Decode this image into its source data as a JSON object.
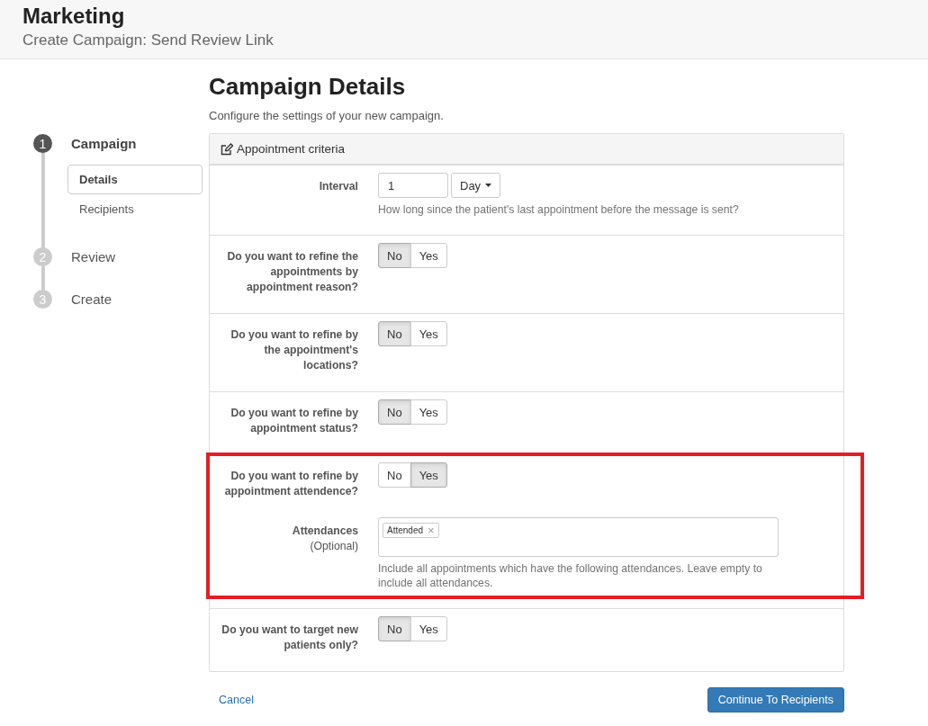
{
  "header": {
    "title": "Marketing",
    "subtitle": "Create Campaign: Send Review Link"
  },
  "steps": [
    {
      "number": "1",
      "label": "Campaign",
      "selected": true,
      "children": [
        {
          "label": "Details",
          "selected": true
        },
        {
          "label": "Recipients",
          "selected": false
        }
      ]
    },
    {
      "number": "2",
      "label": "Review",
      "selected": false
    },
    {
      "number": "3",
      "label": "Create",
      "selected": false
    }
  ],
  "page": {
    "title": "Campaign Details",
    "description": "Configure the settings of your new campaign."
  },
  "panel": {
    "title": "Appointment criteria",
    "fields": [
      {
        "kind": "interval",
        "label": "Interval",
        "value": "1",
        "unit": "Day",
        "help": "How long since the patient's last appointment before the message is sent?"
      },
      {
        "kind": "toggle",
        "label": "Do you want to refine the appointments by appointment reason?",
        "highlighted": false,
        "options": [
          {
            "label": "No",
            "selected": true
          },
          {
            "label": "Yes",
            "selected": false
          }
        ]
      },
      {
        "kind": "toggle",
        "label": "Do you want to refine by the appointment's locations?",
        "highlighted": false,
        "options": [
          {
            "label": "No",
            "selected": true
          },
          {
            "label": "Yes",
            "selected": false
          }
        ]
      },
      {
        "kind": "toggle",
        "label": "Do you want to refine by appointment status?",
        "highlighted": false,
        "options": [
          {
            "label": "No",
            "selected": true
          },
          {
            "label": "Yes",
            "selected": false
          }
        ]
      },
      {
        "kind": "toggle",
        "label": "Do you want to refine by appointment attendence?",
        "highlighted": true,
        "options": [
          {
            "label": "No",
            "selected": false
          },
          {
            "label": "Yes",
            "selected": true
          }
        ],
        "sub": {
          "label": "Attendances",
          "note": "(Optional)",
          "tags": [
            "Attended"
          ],
          "tag_remove": "×",
          "help": "Include all appointments which have the following attendances. Leave empty to include all attendances."
        }
      },
      {
        "kind": "toggle",
        "label": "Do you want to target new patients only?",
        "highlighted": false,
        "options": [
          {
            "label": "No",
            "selected": true
          },
          {
            "label": "Yes",
            "selected": false
          }
        ]
      }
    ]
  },
  "footer": {
    "cancel": "Cancel",
    "continue": "Continue To Recipients"
  }
}
